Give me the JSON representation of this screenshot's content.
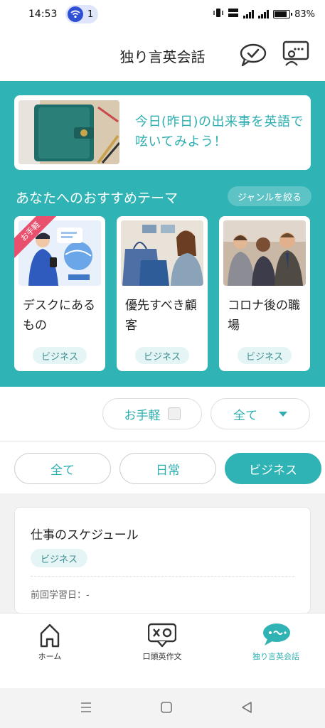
{
  "status_bar": {
    "time": "14:53",
    "hotspot_count": "1",
    "battery": "83%",
    "battery_level": 0.83
  },
  "header": {
    "title": "独り言英会話"
  },
  "banner": {
    "text": "今日(昨日)の出来事を英語で呟いてみよう！"
  },
  "recommend": {
    "title": "あなたへのおすすめテーマ",
    "filter_label": "ジャンルを絞る",
    "cards": [
      {
        "ribbon": "お手軽",
        "title": "デスクにあるもの",
        "tag": "ビジネス"
      },
      {
        "title": "優先すべき顧客",
        "tag": "ビジネス"
      },
      {
        "title": "コロナ後の職場",
        "tag": "ビジネス"
      }
    ]
  },
  "filters": {
    "easy_label": "お手軽",
    "level_value": "全て"
  },
  "tabs": [
    {
      "label": "全て",
      "active": false
    },
    {
      "label": "日常",
      "active": false
    },
    {
      "label": "ビジネス",
      "active": true
    }
  ],
  "list": [
    {
      "title": "仕事のスケジュール",
      "tag": "ビジネス",
      "last_studied": "前回学習日：-"
    }
  ],
  "bottom_nav": [
    {
      "label": "ホーム",
      "icon": "home-icon",
      "active": false
    },
    {
      "label": "口頭英作文",
      "icon": "speech-bubble-icon",
      "active": false
    },
    {
      "label": "独り言英会話",
      "icon": "chat-bubble-icon",
      "active": true
    }
  ],
  "colors": {
    "accent": "#30b3b5",
    "ribbon": "#e8506e"
  }
}
